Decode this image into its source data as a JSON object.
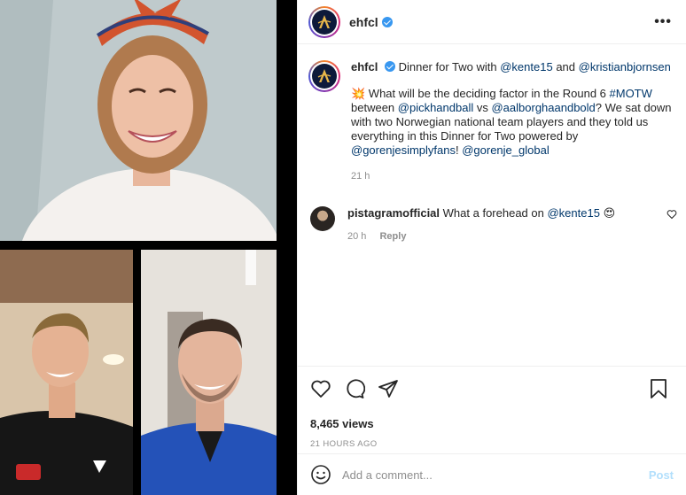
{
  "post": {
    "username": "ehfcl",
    "more_icon": "more-horizontal-icon",
    "caption": {
      "line1_text": "Dinner for Two with ",
      "mention1": "@kente15",
      "and": " and ",
      "mention2": "@kristianbjornsen",
      "emoji": "💥",
      "p2_text1": " What will be the deciding factor in the Round 6 ",
      "hashtag": "#MOTW",
      "p2_text2": " between ",
      "mention3": "@pickhandball",
      "vs": " vs ",
      "mention4": "@aalborghaandbold",
      "p2_text3": "? We sat down with two Norwegian national team players and they told us everything in this Dinner for Two powered by ",
      "mention5": "@gorenjesimplyfans",
      "p2_text4": "! ",
      "mention6": "@gorenje_global",
      "time": "21 h"
    },
    "comment": {
      "username": "pistagramofficial",
      "text": "What a forehead on ",
      "mention": "@kente15",
      "emoji": "😍",
      "time": "20 h",
      "reply_label": "Reply"
    },
    "views": "8,465 views",
    "posted_ago": "21 HOURS AGO",
    "add_comment_placeholder": "Add a comment...",
    "post_label": "Post"
  },
  "colors": {
    "link": "#00376b",
    "post_button": "#b2dffc",
    "verified": "#3897f0",
    "muted": "#8e8e8e"
  }
}
